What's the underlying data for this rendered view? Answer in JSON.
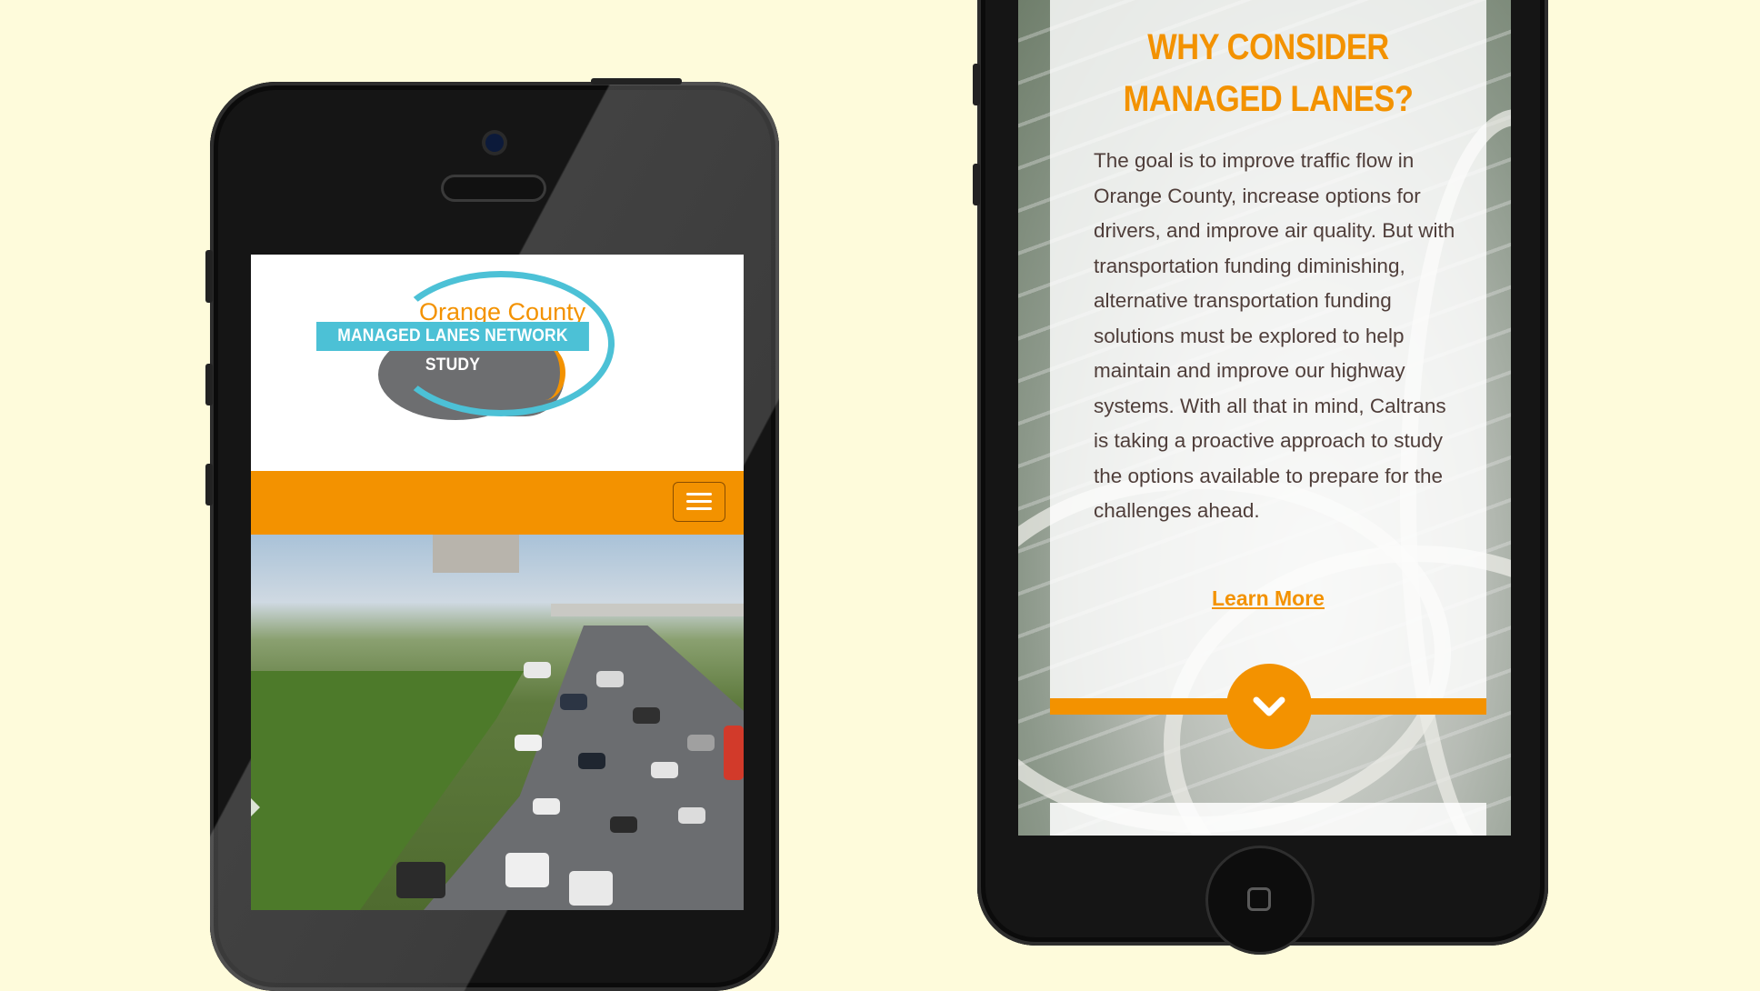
{
  "left_phone": {
    "logo": {
      "county_text": "Orange County",
      "banner_text": "MANAGED LANES NETWORK STUDY"
    },
    "menu_icon": "hamburger-menu-icon",
    "hero_icon": "chevron-right-icon"
  },
  "right_phone": {
    "title": "WHY CONSIDER MANAGED LANES?",
    "body": "The goal is to improve traffic flow in Orange County, increase options for drivers, and improve air quality. But with transportation funding diminishing, alternative transportation funding solutions must be explored to help maintain and improve our highway systems. With all that in mind, Caltrans is taking a proactive approach to study the options available to prepare for the challenges ahead.",
    "learn_more": "Learn More",
    "scroll_icon": "chevron-down-icon"
  },
  "colors": {
    "background": "#fefbdb",
    "accent_orange": "#f39200",
    "logo_teal": "#4cc1d6",
    "body_text": "#4f3e3a"
  }
}
